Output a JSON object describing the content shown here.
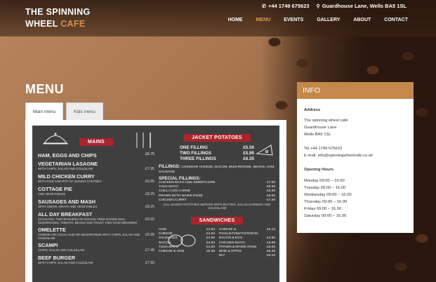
{
  "header": {
    "logo_line1": "THE SPINNING",
    "logo_line2_a": "WHEEL",
    "logo_line2_b": "CAFE",
    "phone": "+44 1749 675623",
    "address": "Guardhouse Lane, Wells BA5 1SL",
    "phone_icon": "phone-icon",
    "location_icon": "map-pin-icon",
    "accent_color": "#d9904a"
  },
  "nav": [
    {
      "label": "HOME"
    },
    {
      "label": "MENU",
      "active": true
    },
    {
      "label": "EVENTS"
    },
    {
      "label": "GALLERY"
    },
    {
      "label": "ABOUT"
    },
    {
      "label": "CONTACT"
    }
  ],
  "page": {
    "title": "MENU",
    "tabs": [
      {
        "label": "Main menu",
        "active": true
      },
      {
        "label": "Kids menu"
      }
    ]
  },
  "menu_board": {
    "mains_title": "MAINS",
    "mains": [
      {
        "name": "HAM, EGGS AND CHIPS",
        "price": "£6.75",
        "sub": ""
      },
      {
        "name": "VEGETARIAN LASAGNE",
        "price": "£7.95",
        "sub": "WITH CHIPS, SALAD AND COLESLAW"
      },
      {
        "name": "MILD CHICKEN CURRY",
        "price": "£6.95",
        "sub": "WITH RICE AND POT OF MANGO CHUTNEY"
      },
      {
        "name": "COTTAGE PIE",
        "price": "£8.25",
        "sub": "AND VEGETABLES"
      },
      {
        "name": "SAUSAGES AND MASH",
        "price": "£8.25",
        "sub": "WITH ONION, GRAVY AND VEGETABLES"
      },
      {
        "name": "ALL DAY BREAKFAST",
        "price": "£6.50",
        "sub": "(SAUSAGE, TWO RASHERS OF BACON, FREE RANGE EGG, MUSHROOMS, TOMATO, BEANS AND TOAST, TWO HASH BROWNS)"
      },
      {
        "name": "OMELETTE",
        "price": "£6.95",
        "sub": "CHEESE OR LOCAL HAM OR MUSHROOMS WITH CHIPS, SALAD AND COLESLAW"
      },
      {
        "name": "SCAMPI",
        "price": "£7.45",
        "sub": "CHIPS, SALAD AND COLESLAW"
      },
      {
        "name": "BEEF BURGER",
        "price": "£7.50",
        "sub": "WITH CHIPS, SALAD AND COLESLAW"
      }
    ],
    "potatoes_title": "JACKET POTATOES",
    "potatoes": [
      {
        "name": "ONE FILLING",
        "price": "£5.50"
      },
      {
        "name": "TWO FILLINGS",
        "price": "£5.95"
      },
      {
        "name": "THREE FILLINGS",
        "price": "£6.35"
      }
    ],
    "fillings_label": "FILLINGS:",
    "fillings_text": "CHEDDAR CHEESE, BACON, MUSHROOMS, BEANS, HAM, SAUSAGE",
    "special_label": "SPECIAL FILLINGS:",
    "specials": [
      {
        "name": "CHICKEN MAYO AND SWEETCORN",
        "price": "£7.00"
      },
      {
        "name": "TUNA MAYO",
        "price": "£5.95"
      },
      {
        "name": "CHILLI CON CARNE",
        "price": "£6.95"
      },
      {
        "name": "PRAWN WITH MARIE ROSE",
        "price": "£6.50"
      },
      {
        "name": "CHICKEN CURRY",
        "price": "£7.25"
      }
    ],
    "potato_note": "(ALL BAKED POTATOES SERVED WITH BUTTER, SALAD GARNISH AND COLESLAW)",
    "sandwiches_title": "SANDWICHES",
    "sandwiches_left": [
      {
        "name": "HAM",
        "price": "£4.50"
      },
      {
        "name": "CHEESE",
        "price": "£4.50"
      },
      {
        "name": "SAUSAGES",
        "price": "£4.95"
      },
      {
        "name": "BACON",
        "price": "£4.50"
      },
      {
        "name": "TUNA MAYO",
        "price": "£4.50"
      },
      {
        "name": "CHEESE & HAM",
        "price": "£5.35"
      }
    ],
    "sandwiches_right": [
      {
        "name": "CHEESE & PICKLE/TOMATO/ONION",
        "price": "£5.15"
      },
      {
        "name": "BACON & EGG",
        "price": "£4.95"
      },
      {
        "name": "CHICKEN MAYO",
        "price": "£5.65"
      },
      {
        "name": "PRAWN & MARIE ROSE",
        "price": "£5.65"
      },
      {
        "name": "BRIE & APPLE",
        "price": "£5.25"
      },
      {
        "name": "BLT",
        "price": "£5.25"
      }
    ],
    "accent_red": "#a9252b"
  },
  "info": {
    "title": "INFO",
    "address_label": "Address",
    "address_lines": [
      "The spinning wheel cafe",
      "Guardhouse Lane",
      "Wells BA5 1SL"
    ],
    "tel": "Tel +44 1749 675623",
    "email": "E-mail: info@spinningwheelcafe.co.uk",
    "hours_label": "Opening Hours",
    "hours": [
      "Monday 09:00 – 16.00",
      "Tuesday 09:00 – 16.00",
      "Wednesday 09:00 – 16.00",
      "Thursday 09:00 – 16.00",
      "Friday 09:00 – 16.00",
      "Saturday 09:00 – 16.00"
    ],
    "accent_color": "#c4884b"
  }
}
